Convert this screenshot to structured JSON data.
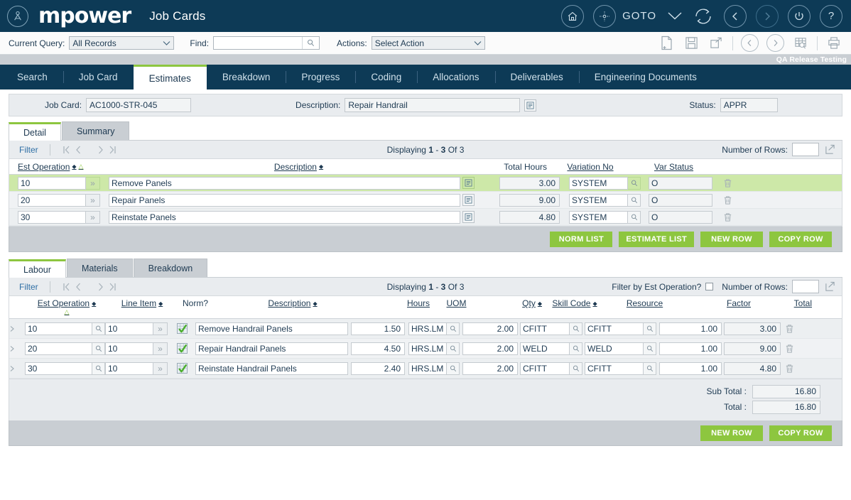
{
  "header": {
    "brand": "mpower",
    "app_title": "Job Cards",
    "goto_label": "GOTO",
    "env_tag": "QA Release Testing",
    "accent_green": "#8dc63f",
    "brand_navy": "#0d3a56"
  },
  "querybar": {
    "current_query_label": "Current Query:",
    "current_query_value": "All Records",
    "find_label": "Find:",
    "find_value": "",
    "find_placeholder": "",
    "actions_label": "Actions:",
    "actions_value": "Select Action"
  },
  "nav_tabs": [
    {
      "label": "Search",
      "active": false
    },
    {
      "label": "Job Card",
      "active": false
    },
    {
      "label": "Estimates",
      "active": true
    },
    {
      "label": "Breakdown",
      "active": false
    },
    {
      "label": "Progress",
      "active": false
    },
    {
      "label": "Coding",
      "active": false
    },
    {
      "label": "Allocations",
      "active": false
    },
    {
      "label": "Deliverables",
      "active": false
    },
    {
      "label": "Engineering Documents",
      "active": false
    }
  ],
  "header_fields": {
    "job_card_label": "Job Card:",
    "job_card_value": "AC1000-STR-045",
    "description_label": "Description:",
    "description_value": "Repair Handrail",
    "status_label": "Status:",
    "status_value": "APPR"
  },
  "estimates": {
    "subtabs": [
      {
        "label": "Detail",
        "active": true
      },
      {
        "label": "Summary",
        "active": false
      }
    ],
    "filter_label": "Filter",
    "displaying": "Displaying 1 - 3 Of 3",
    "displaying_parts": {
      "prefix": "Displaying ",
      "from": "1",
      "dash": " - ",
      "to": "3",
      "suffix": " Of 3"
    },
    "rows_label": "Number of Rows:",
    "rows_value": "",
    "columns": [
      "Est Operation",
      "Description",
      "Total Hours",
      "Variation No",
      "Var Status"
    ],
    "rows": [
      {
        "est_operation": "10",
        "description": "Remove Panels",
        "total_hours": "3.00",
        "variation_no": "SYSTEM",
        "var_status": "O",
        "selected": true
      },
      {
        "est_operation": "20",
        "description": "Repair Panels",
        "total_hours": "9.00",
        "variation_no": "SYSTEM",
        "var_status": "O",
        "selected": false
      },
      {
        "est_operation": "30",
        "description": "Reinstate Panels",
        "total_hours": "4.80",
        "variation_no": "SYSTEM",
        "var_status": "O",
        "selected": false
      }
    ],
    "buttons": [
      "NORM LIST",
      "ESTIMATE LIST",
      "NEW ROW",
      "COPY ROW"
    ]
  },
  "labour": {
    "subtabs": [
      {
        "label": "Labour",
        "active": true
      },
      {
        "label": "Materials",
        "active": false
      },
      {
        "label": "Breakdown",
        "active": false
      }
    ],
    "filter_label": "Filter",
    "displaying": "Displaying 1 - 3 Of 3",
    "displaying_parts": {
      "prefix": "Displaying ",
      "from": "1",
      "dash": " - ",
      "to": "3",
      "suffix": " Of 3"
    },
    "filter_by_est_label": "Filter by Est Operation?",
    "filter_by_est_checked": false,
    "rows_label": "Number of Rows:",
    "rows_value": "",
    "columns": [
      "Est Operation",
      "Line Item",
      "Norm?",
      "Description",
      "Hours",
      "UOM",
      "Qty",
      "Skill Code",
      "Resource",
      "Factor",
      "Total"
    ],
    "rows": [
      {
        "est_operation": "10",
        "line_item": "10",
        "norm": true,
        "description": "Remove Handrail Panels",
        "hours": "1.50",
        "uom": "HRS.LM",
        "qty": "2.00",
        "skill_code": "CFITT",
        "resource": "CFITT",
        "factor": "1.00",
        "total": "3.00"
      },
      {
        "est_operation": "20",
        "line_item": "10",
        "norm": true,
        "description": "Repair Handrail Panels",
        "hours": "4.50",
        "uom": "HRS.LM",
        "qty": "2.00",
        "skill_code": "WELD",
        "resource": "WELD",
        "factor": "1.00",
        "total": "9.00"
      },
      {
        "est_operation": "30",
        "line_item": "10",
        "norm": true,
        "description": "Reinstate Handrail Panels",
        "hours": "2.40",
        "uom": "HRS.LM",
        "qty": "2.00",
        "skill_code": "CFITT",
        "resource": "CFITT",
        "factor": "1.00",
        "total": "4.80"
      }
    ],
    "sub_total_label": "Sub Total :",
    "sub_total_value": "16.80",
    "total_label": "Total :",
    "total_value": "16.80",
    "buttons": [
      "NEW ROW",
      "COPY ROW"
    ]
  }
}
